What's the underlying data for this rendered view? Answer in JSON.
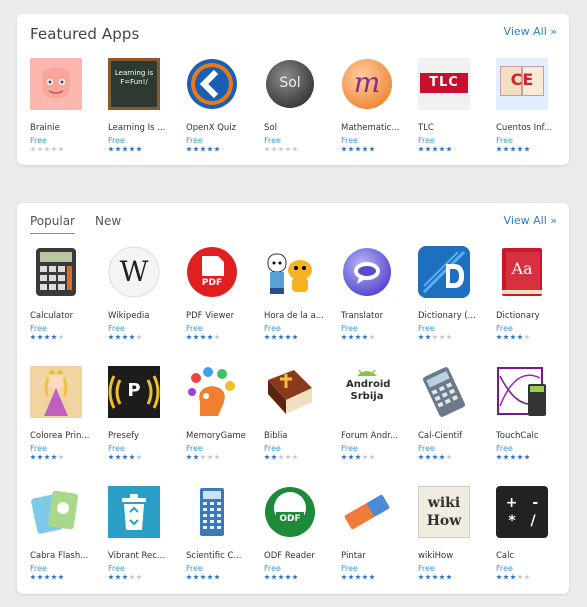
{
  "featured": {
    "title": "Featured Apps",
    "view_all": "View All »",
    "apps": [
      {
        "name": "Brainie",
        "price": "Free",
        "rating": 0
      },
      {
        "name": "Learning Is ...",
        "price": "Free",
        "rating": 5
      },
      {
        "name": "OpenX Quiz",
        "price": "Free",
        "rating": 5
      },
      {
        "name": "Sol",
        "price": "Free",
        "rating": 0
      },
      {
        "name": "Mathematic...",
        "price": "Free",
        "rating": 5
      },
      {
        "name": "TLC",
        "price": "Free",
        "rating": 5
      },
      {
        "name": "Cuentos Inf...",
        "price": "Free",
        "rating": 5
      }
    ],
    "icon_texts": {
      "learning": "Learning is F=Fun!/",
      "sol": "Sol",
      "math": "m",
      "tlc": "TLC",
      "cuentos": "CE"
    }
  },
  "popular": {
    "tabs": [
      "Popular",
      "New"
    ],
    "view_all": "View All »",
    "apps": [
      {
        "name": "Calculator",
        "price": "Free",
        "rating": 4
      },
      {
        "name": "Wikipedia",
        "price": "Free",
        "rating": 4
      },
      {
        "name": "PDF Viewer",
        "price": "Free",
        "rating": 4
      },
      {
        "name": "Hora de la a...",
        "price": "Free",
        "rating": 5
      },
      {
        "name": "Translator",
        "price": "Free",
        "rating": 4
      },
      {
        "name": "Dictionary (...",
        "price": "Free",
        "rating": 2
      },
      {
        "name": "Dictionary",
        "price": "Free",
        "rating": 4
      },
      {
        "name": "Colorea Prin...",
        "price": "Free",
        "rating": 4
      },
      {
        "name": "Presefy",
        "price": "Free",
        "rating": 4
      },
      {
        "name": "MemoryGame",
        "price": "Free",
        "rating": 2
      },
      {
        "name": "Biblia",
        "price": "Free",
        "rating": 2
      },
      {
        "name": "Forum Andr...",
        "price": "Free",
        "rating": 3
      },
      {
        "name": "Cal-Cientif",
        "price": "Free",
        "rating": 4
      },
      {
        "name": "TouchCalc",
        "price": "Free",
        "rating": 5
      },
      {
        "name": "Cabra Flash...",
        "price": "Free",
        "rating": 5
      },
      {
        "name": "Vibrant Rec...",
        "price": "Free",
        "rating": 3
      },
      {
        "name": "Scientific C...",
        "price": "Free",
        "rating": 5
      },
      {
        "name": "ODF Reader",
        "price": "Free",
        "rating": 5
      },
      {
        "name": "Pintar",
        "price": "Free",
        "rating": 5
      },
      {
        "name": "wikiHow",
        "price": "Free",
        "rating": 5
      },
      {
        "name": "Calc",
        "price": "Free",
        "rating": 3
      }
    ],
    "icon_texts": {
      "wiki": "W",
      "pdf": "PDF",
      "dict": "Aa",
      "presefy": "P",
      "bible": "B",
      "android": "Android Srbija",
      "odf": "ODF",
      "wikihow_top": "wiki",
      "wikihow_bottom": "How",
      "calc": "+ - * /"
    }
  },
  "colors": {
    "accent": "#2f7fc2",
    "tab_underline": "#e07a1f",
    "star_on": "#2e6fb5",
    "star_off": "#c8c8c8",
    "price": "#3a9bd8"
  }
}
